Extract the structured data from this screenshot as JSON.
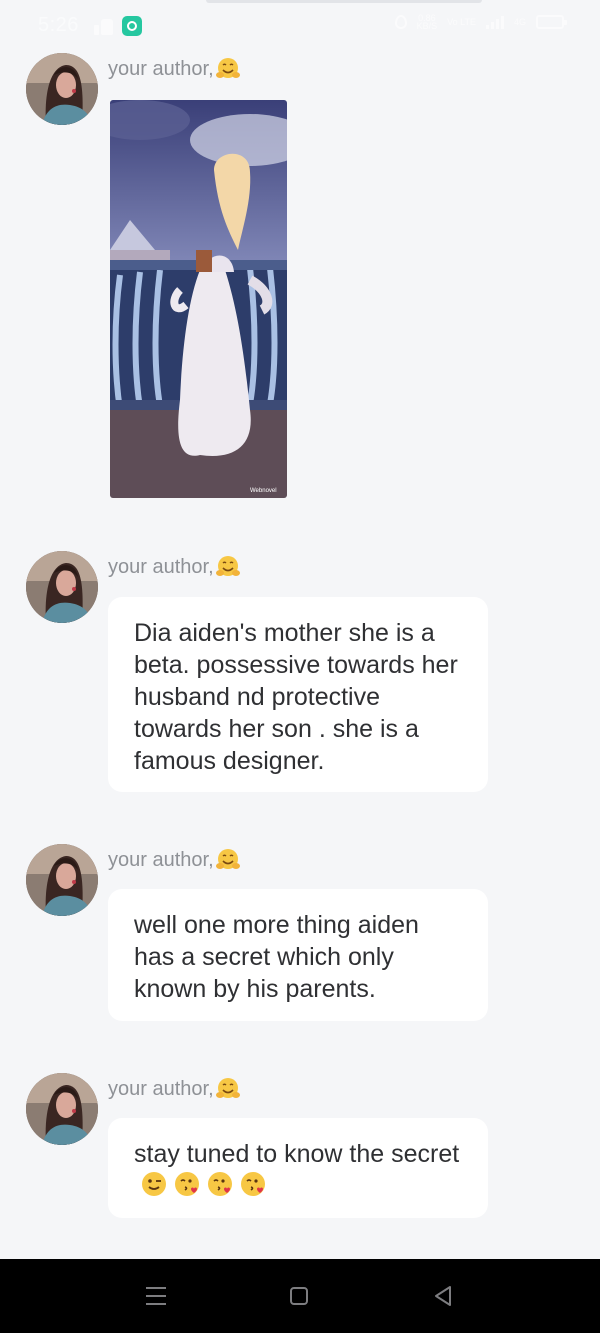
{
  "status_bar": {
    "time": "5:26",
    "net_speed_value": "0.86",
    "net_speed_unit": "KB/S",
    "net_type": "4G",
    "network_label": "Vo LTE",
    "battery_level": 0.0
  },
  "messages": [
    {
      "author": "your author,",
      "author_emoji": "hugging-face-icon",
      "type": "image",
      "image_watermark": "Webnovel"
    },
    {
      "author": "your author,",
      "author_emoji": "hugging-face-icon",
      "type": "text",
      "text": "Dia aiden's mother she is a beta. possessive towards her husband nd protective towards her son . she is a famous designer."
    },
    {
      "author": "your author,",
      "author_emoji": "hugging-face-icon",
      "type": "text",
      "text": "well one more thing aiden has a secret which only known by his parents."
    },
    {
      "author": "your author,",
      "author_emoji": "hugging-face-icon",
      "type": "text",
      "text": "stay tuned to know the secret",
      "trailing_emojis": [
        "winking-face-icon",
        "kissing-heart-icon",
        "kissing-heart-icon",
        "kissing-heart-icon"
      ]
    }
  ],
  "nav_bar": {
    "items": [
      "menu-icon",
      "home-icon",
      "back-icon"
    ]
  }
}
